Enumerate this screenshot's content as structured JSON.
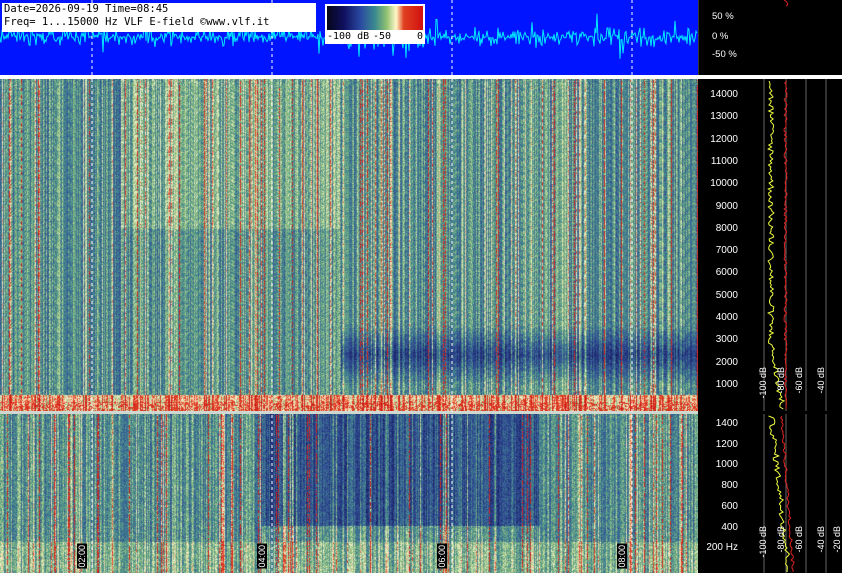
{
  "info": {
    "line1": "Date=2026-09-19 Time=08:45",
    "line2": "Freq= 1...15000 Hz   VLF E-field ©www.vlf.it"
  },
  "colorbar": {
    "labels": [
      "-100 dB",
      "-50",
      "0"
    ]
  },
  "waveform_axis": [
    "50 %",
    "0 %",
    "-50 %"
  ],
  "freq_axis_top": [
    "14000",
    "13000",
    "12000",
    "11000",
    "10000",
    "9000",
    "8000",
    "7000",
    "6000",
    "5000",
    "4000",
    "3000",
    "2000",
    "1000"
  ],
  "freq_axis_bottom": [
    "1400",
    "1200",
    "1000",
    "800",
    "600",
    "400",
    "200 Hz"
  ],
  "time_labels": [
    "02:00",
    "04:00",
    "06:00",
    "08:00"
  ],
  "db_labels": [
    "-100 dB",
    "-80 dB",
    "-60 dB",
    "-40 dB",
    "-20 dB"
  ],
  "colors": {
    "waveform_bg": "#0014ff",
    "waveform_trace": "#00e8ff",
    "spectrum_trace_yellow": "#f0ff40",
    "spectrum_trace_red": "#e02020"
  }
}
